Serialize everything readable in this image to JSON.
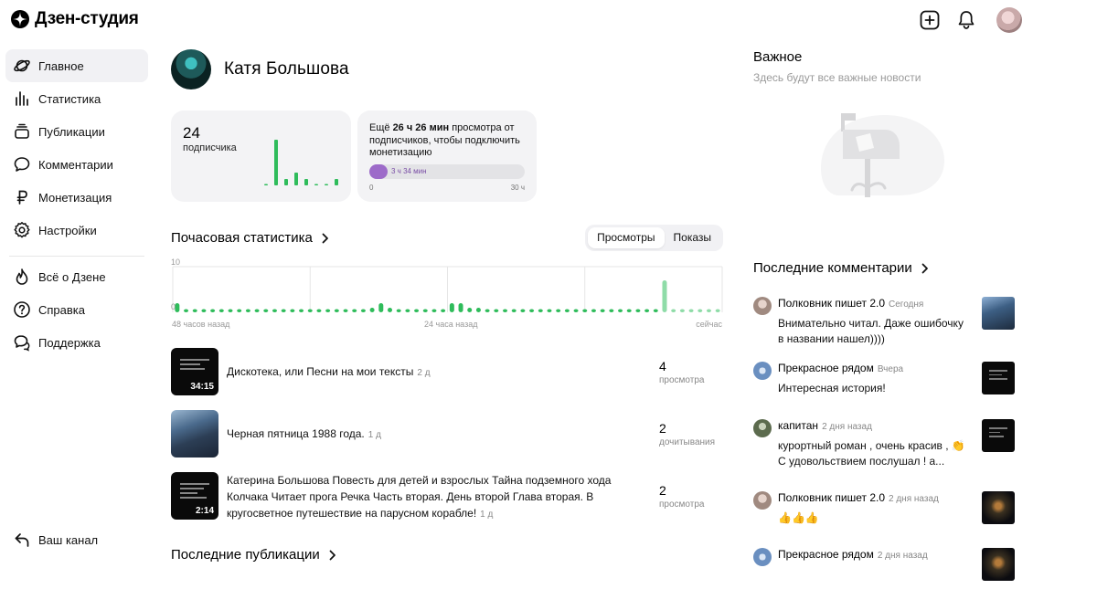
{
  "app": {
    "title": "Дзен-студия"
  },
  "sidebar": {
    "items": [
      {
        "label": "Главное",
        "icon": "planet-icon",
        "active": true
      },
      {
        "label": "Статистика",
        "icon": "bar-chart-icon"
      },
      {
        "label": "Публикации",
        "icon": "stack-icon"
      },
      {
        "label": "Комментарии",
        "icon": "comment-icon"
      },
      {
        "label": "Монетизация",
        "icon": "ruble-icon"
      },
      {
        "label": "Настройки",
        "icon": "gear-icon"
      }
    ],
    "secondary": [
      {
        "label": "Всё о Дзене",
        "icon": "flame-icon"
      },
      {
        "label": "Справка",
        "icon": "help-icon"
      },
      {
        "label": "Поддержка",
        "icon": "chat-bubbles-icon"
      }
    ],
    "bottom": {
      "label": "Ваш канал",
      "icon": "return-arrow-icon"
    }
  },
  "profile": {
    "name": "Катя Большова"
  },
  "subscribers": {
    "count": "24",
    "label": "подписчика",
    "bars": [
      0.02,
      1.0,
      0.14,
      0.28,
      0.14,
      0.02,
      0.02,
      0.14
    ]
  },
  "monetization": {
    "text_before": "Ещё ",
    "highlight": "26 ч 26 мин",
    "text_after": " просмотра от подписчиков, чтобы подключить монетизацию",
    "progress_label": "3 ч 34 мин",
    "progress": 0.119,
    "min": "0",
    "max": "30 ч"
  },
  "hourly": {
    "title": "Почасовая статистика",
    "tabs": [
      "Просмотры",
      "Показы"
    ],
    "active_tab": 0,
    "y_top": "10",
    "y_bottom": "0",
    "x_left": "48 часов назад",
    "x_mid": "24 часа назад",
    "x_right": "сейчас"
  },
  "chart_data": {
    "type": "bar",
    "title": "Почасовая статистика",
    "xlabel": "",
    "ylabel": "",
    "ylim": [
      0,
      10
    ],
    "x_ticks": [
      "48 часов назад",
      "24 часа назад",
      "сейчас"
    ],
    "series": [
      {
        "values": [
          2,
          0,
          0,
          0,
          0,
          0,
          0,
          0,
          0,
          0,
          0,
          0,
          0,
          0,
          0,
          0,
          0,
          0,
          0,
          0,
          0,
          0,
          1,
          2,
          1,
          0,
          0,
          0,
          0,
          0,
          0,
          2,
          2,
          1,
          1,
          0,
          0,
          0,
          0,
          0,
          0,
          0,
          0,
          0,
          0,
          0,
          0,
          0,
          0,
          0,
          0,
          0,
          0,
          0,
          0,
          7,
          0,
          0,
          0,
          0,
          0,
          0
        ]
      }
    ]
  },
  "publications": [
    {
      "title": "Дискотека, или Песни на мои тексты",
      "age": "2 д",
      "value": "4",
      "metric": "просмотра",
      "duration": "34:15",
      "thumb": "dark"
    },
    {
      "title": "Черная пятница 1988 года.",
      "age": "1 д",
      "value": "2",
      "metric": "дочитывания",
      "duration": "",
      "thumb": "photo"
    },
    {
      "title": "Катерина Большова Повесть для детей и взрослых Тайна подземного хода Колчака Читает прога Речка Часть вторая. День второй Глава вторая. В кругосветное путешествие на парусном корабле!",
      "age": "1 д",
      "value": "2",
      "metric": "просмотра",
      "duration": "2:14",
      "thumb": "dark"
    }
  ],
  "last_publications": {
    "title": "Последние публикации"
  },
  "important": {
    "title": "Важное",
    "subtitle": "Здесь будут все важные новости"
  },
  "comments": {
    "title": "Последние комментарии",
    "items": [
      {
        "author": "Полковник пишет 2.0",
        "time": "Сегодня",
        "text": "Внимательно читал. Даже ошибочку в названии нашел))))",
        "avatar": "#c9b8b0",
        "thumb": "photo"
      },
      {
        "author": "Прекрасное рядом",
        "time": "Вчера",
        "text": "Интересная история!",
        "avatar": "#6a8fc0",
        "thumb": "dark"
      },
      {
        "author": "капитан",
        "time": "2 дня назад",
        "text": "курортный роман , очень красив , 👏 С удовольствием послушал ! а...",
        "avatar": "#7c8f6a",
        "thumb": "dark"
      },
      {
        "author": "Полковник пишет 2.0",
        "time": "2 дня назад",
        "text": "👍👍👍",
        "avatar": "#c9b8b0",
        "thumb": "night"
      },
      {
        "author": "Прекрасное рядом",
        "time": "2 дня назад",
        "text": "",
        "avatar": "#6a8fc0",
        "thumb": "night"
      }
    ]
  },
  "colors": {
    "accent_green": "#2fbc5b",
    "pale_green": "#8fdca8",
    "purple": "#9d6bc9",
    "card_bg": "#f3f3f5"
  }
}
